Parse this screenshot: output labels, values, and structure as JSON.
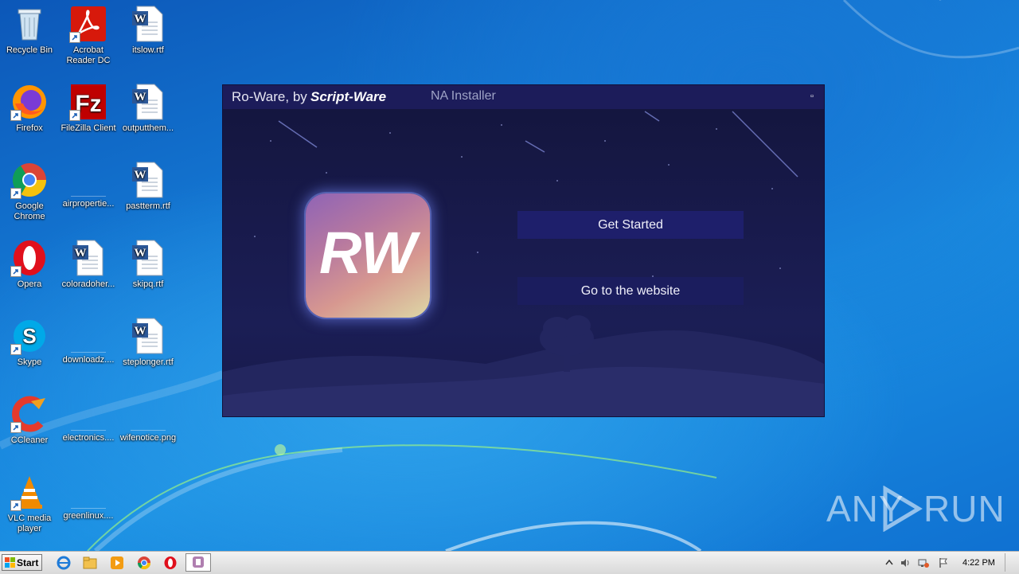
{
  "desktop": {
    "icons": [
      {
        "label": "Recycle Bin",
        "icon": "recycle-bin-icon"
      },
      {
        "label": "Acrobat Reader DC",
        "icon": "acrobat-icon"
      },
      {
        "label": "itslow.rtf",
        "icon": "word-doc-icon"
      },
      {
        "label": "Firefox",
        "icon": "firefox-icon"
      },
      {
        "label": "FileZilla Client",
        "icon": "filezilla-icon"
      },
      {
        "label": "outputthem...",
        "icon": "word-doc-icon"
      },
      {
        "label": "Google Chrome",
        "icon": "chrome-icon"
      },
      {
        "label": "airpropertie...",
        "icon": "blank-file-icon"
      },
      {
        "label": "pastterm.rtf",
        "icon": "word-doc-icon"
      },
      {
        "label": "Opera",
        "icon": "opera-icon"
      },
      {
        "label": "coloradoher...",
        "icon": "word-doc-icon"
      },
      {
        "label": "skipq.rtf",
        "icon": "word-doc-icon"
      },
      {
        "label": "Skype",
        "icon": "skype-icon"
      },
      {
        "label": "downloadz....",
        "icon": "blank-file-icon"
      },
      {
        "label": "steplonger.rtf",
        "icon": "word-doc-icon"
      },
      {
        "label": "CCleaner",
        "icon": "ccleaner-icon"
      },
      {
        "label": "electronics....",
        "icon": "blank-file-icon"
      },
      {
        "label": "wifenotice.png",
        "icon": "blank-file-icon"
      },
      {
        "label": "VLC media player",
        "icon": "vlc-icon"
      },
      {
        "label": "greenlinux....",
        "icon": "blank-file-icon"
      }
    ]
  },
  "window": {
    "title_prefix": "Ro-Ware, by",
    "title_brand": "Script-Ware",
    "subtitle": "NA Installer",
    "maximize_glyph": "▫",
    "logo_text": "RW",
    "buttons": {
      "get_started": "Get Started",
      "website": "Go to the website"
    }
  },
  "watermark": {
    "left": "ANY",
    "right": "RUN"
  },
  "taskbar": {
    "start_label": "Start",
    "pinned": [
      "ie-icon",
      "explorer-icon",
      "media-player-icon",
      "chrome-icon",
      "opera-icon",
      "installer-icon"
    ],
    "clock": "4:22 PM"
  }
}
